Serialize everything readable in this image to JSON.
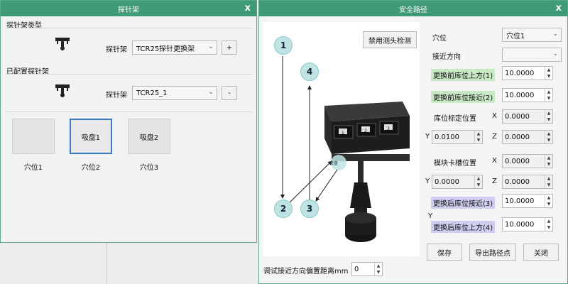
{
  "left_window": {
    "title": "探针架",
    "close": "x",
    "type_section": "探针架类型",
    "type_label": "探针架",
    "type_value": "TCR25探针更换架",
    "add_label": "+",
    "configured_section": "已配置探针架",
    "configured_label": "探针架",
    "configured_value": "TCR25_1",
    "remove_label": "-",
    "tiles": [
      {
        "text": "",
        "label": "穴位1"
      },
      {
        "text": "吸盘1",
        "label": "穴位2"
      },
      {
        "text": "吸盘2",
        "label": "穴位3"
      }
    ]
  },
  "right_window": {
    "title": "安全路径",
    "close": "x",
    "disable_button": "禁用测头检测",
    "bubbles": [
      "1",
      "2",
      "3",
      "4"
    ],
    "slot_label": "穴位",
    "slot_value": "穴位1",
    "approach_label": "接近方向",
    "approach_value": "",
    "pre_above_label": "更换前库位上方(1)",
    "pre_above_value": "10.0000",
    "pre_near_label": "更换前库位接近(2)",
    "pre_near_value": "10.0000",
    "calib_label": "库位标定位置",
    "calib_x": "0.0000",
    "calib_y": "0.0100",
    "calib_z": "0.0000",
    "module_label": "模块卡槽位置",
    "module_x": "0.0000",
    "module_y": "0.0000",
    "module_z": "0.0000",
    "post_near_label": "更换后库位接近(3)",
    "post_near_value": "10.0000",
    "post_above_label": "更换后库位上方(4)",
    "post_above_value": "10.0000",
    "x_axis": "X",
    "y_axis": "Y",
    "z_axis": "Z",
    "save_button": "保存",
    "export_button": "导出路径点",
    "close_button": "关闭",
    "offset_label": "调试接近方向偏置距离mm",
    "offset_value": "0",
    "slot_labels": [
      "1",
      "2",
      "3"
    ],
    "chip_label": "吸盘"
  }
}
